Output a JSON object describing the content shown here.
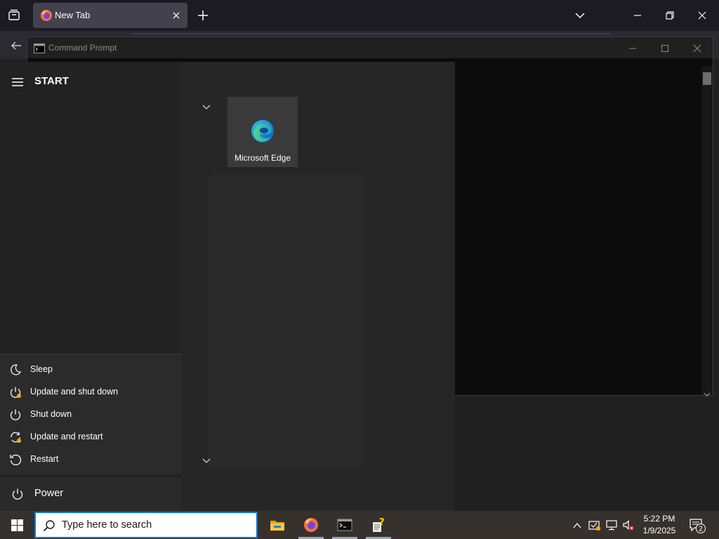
{
  "browser": {
    "tab_title": "New Tab"
  },
  "cmd": {
    "title": "Command Prompt"
  },
  "start_menu": {
    "title": "START",
    "tile": {
      "label": "Microsoft Edge",
      "icon": "edge-icon"
    },
    "power_options": [
      {
        "label": "Sleep",
        "icon": "moon-icon"
      },
      {
        "label": "Update and shut down",
        "icon": "power-update-icon"
      },
      {
        "label": "Shut down",
        "icon": "power-icon"
      },
      {
        "label": "Update and restart",
        "icon": "restart-update-icon"
      },
      {
        "label": "Restart",
        "icon": "restart-icon"
      }
    ],
    "power_button": {
      "label": "Power",
      "icon": "power-icon"
    }
  },
  "taskbar": {
    "search_placeholder": "Type here to search",
    "pinned": [
      {
        "name": "file-explorer",
        "icon": "folder-icon"
      },
      {
        "name": "firefox",
        "icon": "firefox-icon"
      },
      {
        "name": "command-prompt",
        "icon": "terminal-icon"
      },
      {
        "name": "help",
        "icon": "help-icon"
      }
    ],
    "clock": {
      "time": "5:22 PM",
      "date": "1/9/2025"
    },
    "notification_count": "2"
  },
  "colors": {
    "accent": "#0078d4",
    "taskbar": "#36312d",
    "update_dot": "#f7a51c"
  }
}
